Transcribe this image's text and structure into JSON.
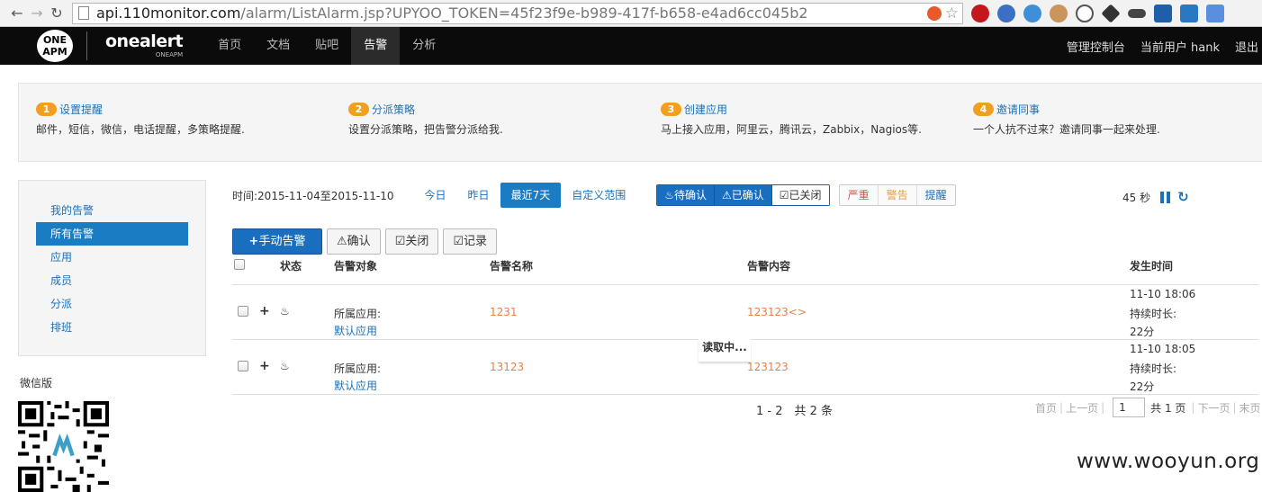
{
  "browser": {
    "url_host": "api.110monitor.com",
    "url_path": "/alarm/ListAlarm.jsp?UPYOO_TOKEN=45f23f9e-b989-417f-b658-e4ad6cc045b2"
  },
  "header": {
    "logo_line1": "ONE",
    "logo_line2": "APM",
    "brand": "onealert",
    "brand_sub": "ONEAPM",
    "nav": [
      "首页",
      "文档",
      "贴吧",
      "告警",
      "分析"
    ],
    "active_nav": "告警",
    "right": [
      "管理控制台",
      "当前用户 hank",
      "退出"
    ]
  },
  "steps": [
    {
      "num": "1",
      "title": "设置提醒",
      "desc": "邮件，短信，微信，电话提醒，多策略提醒."
    },
    {
      "num": "2",
      "title": "分派策略",
      "desc": "设置分派策略，把告警分派给我."
    },
    {
      "num": "3",
      "title": "创建应用",
      "desc": "马上接入应用，阿里云，腾讯云，Zabbix，Nagios等."
    },
    {
      "num": "4",
      "title": "邀请同事",
      "desc": "一个人抗不过来？邀请同事一起来处理."
    }
  ],
  "sidebar": {
    "items": [
      "我的告警",
      "所有告警",
      "应用",
      "成员",
      "分派",
      "排班"
    ],
    "wechat_title": "微信版"
  },
  "filters": {
    "time_label": "时间:2015-11-04至2015-11-10",
    "quick": [
      "今日",
      "昨日",
      "最近7天",
      "自定义范围"
    ],
    "status": [
      "待确认",
      "已确认",
      "已关闭"
    ],
    "levels": [
      "严重",
      "警告",
      "提醒"
    ],
    "countdown": "45 秒"
  },
  "actions": [
    "手动告警",
    "确认",
    "关闭",
    "记录"
  ],
  "table": {
    "headers": [
      "状态",
      "告警对象",
      "告警名称",
      "告警内容",
      "发生时间"
    ],
    "rows": [
      {
        "object_label": "所属应用:",
        "object_app": "默认应用",
        "name": "1231",
        "content": "123123<>",
        "time": "11-10 18:06",
        "duration_label": "持续时长:",
        "duration": "22分"
      },
      {
        "object_label": "所属应用:",
        "object_app": "默认应用",
        "name": "13123",
        "content": "123123",
        "time": "11-10 18:05",
        "duration_label": "持续时长:",
        "duration": "22分"
      }
    ],
    "loading": "读取中..."
  },
  "pagination": {
    "info": "1 - 2　共 2 条",
    "first": "首页",
    "prev": "上一页",
    "current": "1",
    "total": "共 1 页",
    "next": "下一页",
    "last": "末页"
  },
  "watermark": "www.wooyun.org",
  "colors": {
    "accent": "#1a6ec0",
    "step_badge": "#f0a01e",
    "alert_text": "#e8804a",
    "severe": "#d9534f",
    "warn": "#e8a040",
    "info": "#1a70b8"
  }
}
